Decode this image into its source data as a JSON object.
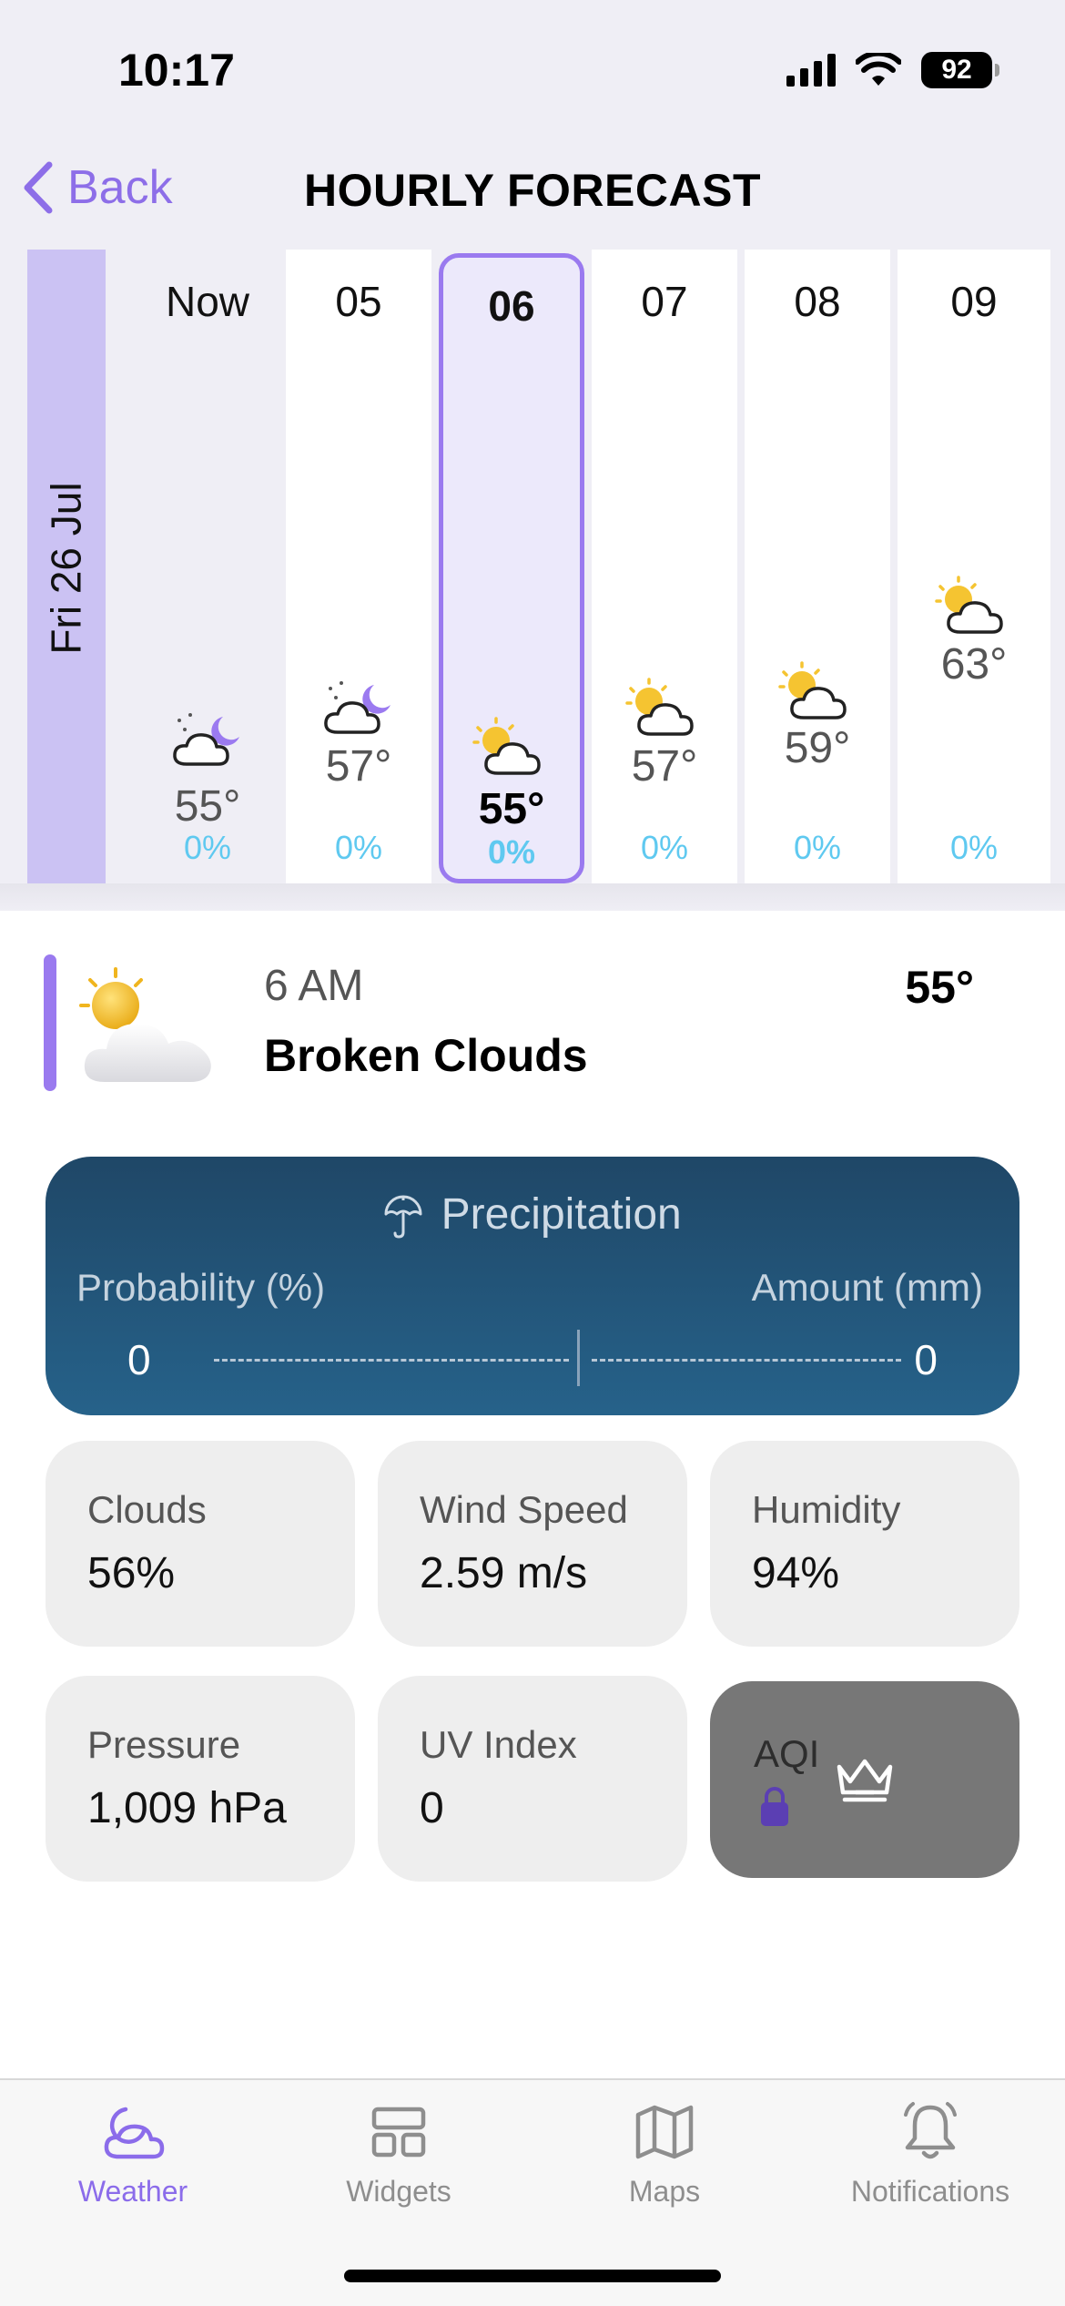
{
  "status_bar": {
    "time": "10:17",
    "battery": "92"
  },
  "nav": {
    "back_label": "Back",
    "title": "HOURLY FORECAST"
  },
  "date_label": "Fri 26 Jul",
  "hours": [
    {
      "label": "Now",
      "temp": "55°",
      "pop": "0%",
      "icon": "partly-cloudy-night-icon"
    },
    {
      "label": "05",
      "temp": "57°",
      "pop": "0%",
      "icon": "partly-cloudy-night-icon"
    },
    {
      "label": "06",
      "temp": "55°",
      "pop": "0%",
      "icon": "partly-cloudy-day-icon",
      "selected": true
    },
    {
      "label": "07",
      "temp": "57°",
      "pop": "0%",
      "icon": "partly-cloudy-day-icon"
    },
    {
      "label": "08",
      "temp": "59°",
      "pop": "0%",
      "icon": "partly-cloudy-day-icon"
    },
    {
      "label": "09",
      "temp": "63°",
      "pop": "0%",
      "icon": "partly-cloudy-day-icon"
    }
  ],
  "detail": {
    "time": "6 AM",
    "description": "Broken Clouds",
    "temp": "55°",
    "icon": "broken-clouds-icon"
  },
  "precipitation": {
    "title": "Precipitation",
    "probability_label": "Probability (%)",
    "amount_label": "Amount (mm)",
    "probability_value": "0",
    "amount_value": "0"
  },
  "tiles": [
    {
      "label": "Clouds",
      "value": "56%"
    },
    {
      "label": "Wind Speed",
      "value": "2.59 m/s"
    },
    {
      "label": "Humidity",
      "value": "94%"
    },
    {
      "label": "Pressure",
      "value": "1,009 hPa"
    },
    {
      "label": "UV Index",
      "value": "0"
    },
    {
      "label": "AQI",
      "value": "",
      "locked": true
    }
  ],
  "tabs": [
    {
      "label": "Weather",
      "icon": "weather-icon",
      "active": true
    },
    {
      "label": "Widgets",
      "icon": "widgets-icon"
    },
    {
      "label": "Maps",
      "icon": "map-icon"
    },
    {
      "label": "Notifications",
      "icon": "bell-icon"
    }
  ],
  "colors": {
    "accent": "#9a7aef",
    "precip_card": "#1f4767",
    "pop_text": "#5fc9f0",
    "date_column": "#cbc2f3"
  }
}
